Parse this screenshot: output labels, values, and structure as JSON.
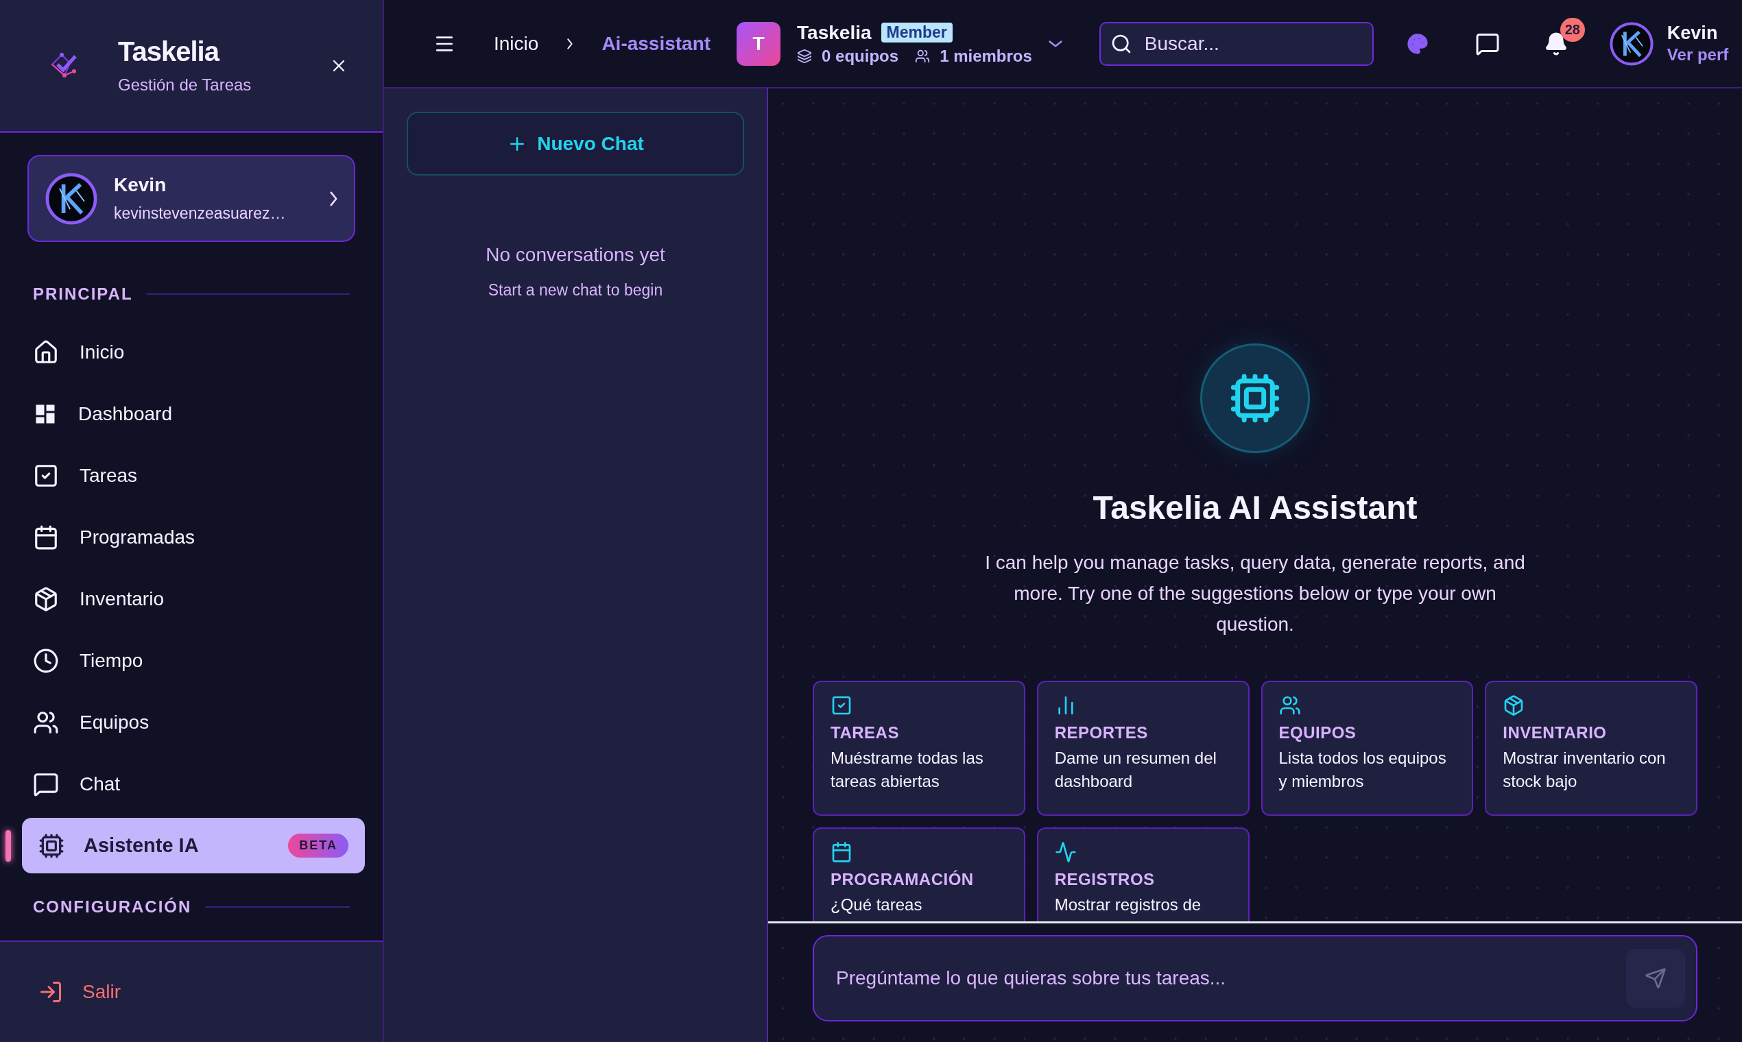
{
  "sidebar": {
    "brand": {
      "title": "Taskelia",
      "subtitle": "Gestión de Tareas"
    },
    "user": {
      "name": "Kevin",
      "email": "kevinstevenzeasuarez…"
    },
    "sections": [
      {
        "label": "PRINCIPAL",
        "items": [
          {
            "label": "Inicio",
            "selected": false
          },
          {
            "label": "Dashboard",
            "selected": false
          },
          {
            "label": "Tareas",
            "selected": false
          },
          {
            "label": "Programadas",
            "selected": false
          },
          {
            "label": "Inventario",
            "selected": false
          },
          {
            "label": "Tiempo",
            "selected": false
          },
          {
            "label": "Equipos",
            "selected": false
          },
          {
            "label": "Chat",
            "selected": false
          },
          {
            "label": "Asistente IA",
            "selected": true,
            "badge": "BETA"
          }
        ]
      },
      {
        "label": "CONFIGURACIÓN"
      }
    ],
    "logout": "Salir"
  },
  "topbar": {
    "breadcrumbs": [
      {
        "label": "Inicio",
        "selected": false
      },
      {
        "label": "Ai-assistant",
        "selected": true
      }
    ],
    "workspace": {
      "initial": "T",
      "name": "Taskelia",
      "role": "Member",
      "teams": "0 equipos",
      "members": "1 miembros"
    },
    "search": {
      "placeholder": "Buscar..."
    },
    "notifications": "28",
    "user": {
      "name": "Kevin",
      "subtitle": "Ver perf"
    }
  },
  "chat_list": {
    "new_chat": "Nuevo Chat",
    "empty_title": "No conversations yet",
    "empty_hint": "Start a new chat to begin"
  },
  "assistant": {
    "title": "Taskelia AI Assistant",
    "description": "I can help you manage tasks, query data, generate reports, and more. Try one of the suggestions below or type your own question.",
    "suggestions": [
      {
        "title": "TAREAS",
        "text": "Muéstrame todas las tareas abiertas"
      },
      {
        "title": "REPORTES",
        "text": "Dame un resumen del dashboard"
      },
      {
        "title": "EQUIPOS",
        "text": "Lista todos los equipos y miembros"
      },
      {
        "title": "INVENTARIO",
        "text": "Mostrar inventario con stock bajo"
      },
      {
        "title": "PROGRAMACIÓN",
        "text": "¿Qué tareas"
      },
      {
        "title": "REGISTROS",
        "text": "Mostrar registros de"
      }
    ],
    "input": {
      "placeholder": "Pregúntame lo que quieras sobre tus tareas..."
    }
  }
}
